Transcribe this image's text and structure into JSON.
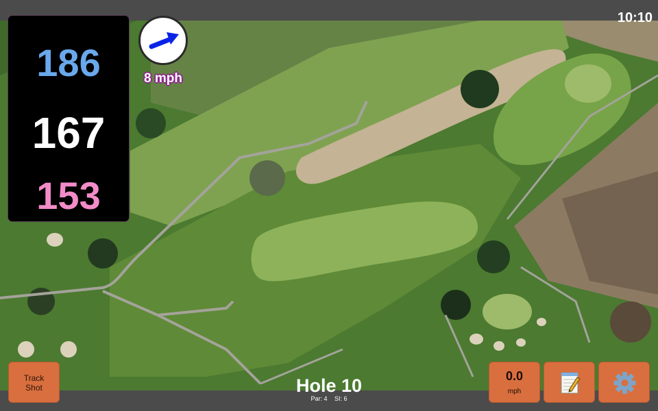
{
  "status": {
    "time": "10:10"
  },
  "distances": {
    "back": "186",
    "middle": "167",
    "front": "153"
  },
  "colors": {
    "back": "#6aa8ec",
    "middle": "#ffffff",
    "front": "#f28cc8",
    "button": "#d96f3e",
    "wind_arrow": "#0a24e6"
  },
  "wind": {
    "speed": "8 mph",
    "direction_icon": "wind-arrow-icon"
  },
  "buttons": {
    "track_line1": "Track",
    "track_line2": "Shot",
    "speed_value": "0.0",
    "speed_unit": "mph",
    "notes_icon": "notepad-icon",
    "settings_icon": "gear-icon"
  },
  "hole": {
    "title": "Hole 10",
    "par": "Par: 4",
    "si": "SI: 6"
  }
}
